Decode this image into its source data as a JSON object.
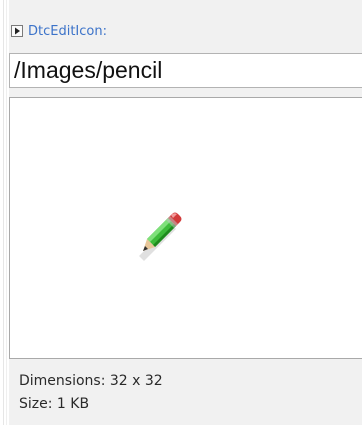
{
  "property": {
    "name": "DtcEditIcon:",
    "value": "/Images/pencil",
    "expander_icon": "expand-triangle-icon"
  },
  "preview": {
    "icon": "pencil-icon",
    "dimensions_label": "Dimensions: 32 x 32",
    "size_label": "Size: 1 KB"
  },
  "colors": {
    "title": "#3c73c9",
    "panel_bg": "#f1f1f1",
    "pencil_green": "#3dbb3a",
    "pencil_eraser": "#d23a3a"
  }
}
